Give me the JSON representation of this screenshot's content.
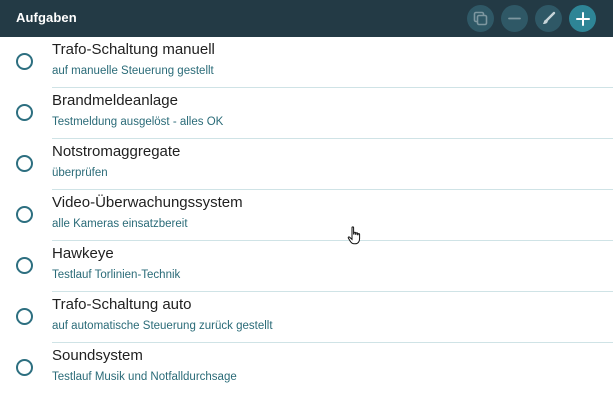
{
  "header": {
    "title": "Aufgaben",
    "buttons": [
      {
        "icon": "copy-icon"
      },
      {
        "icon": "minus-icon"
      },
      {
        "icon": "brush-icon"
      },
      {
        "icon": "plus-icon"
      }
    ]
  },
  "tasks": [
    {
      "title": "Trafo-Schaltung manuell",
      "subtitle": "auf manuelle Steuerung gestellt"
    },
    {
      "title": "Brandmeldeanlage",
      "subtitle": "Testmeldung ausgelöst - alles OK"
    },
    {
      "title": "Notstromaggregate",
      "subtitle": "überprüfen"
    },
    {
      "title": "Video-Überwachungssystem",
      "subtitle": "alle Kameras einsatzbereit"
    },
    {
      "title": "Hawkeye",
      "subtitle": "Testlauf Torlinien-Technik"
    },
    {
      "title": "Trafo-Schaltung auto",
      "subtitle": "auf automatische Steuerung zurück gestellt"
    },
    {
      "title": "Soundsystem",
      "subtitle": "Testlauf Musik und Notfalldurchsage"
    }
  ],
  "colors": {
    "header_bg": "#233a45",
    "accent": "#2e8596",
    "subtitle": "#2a6b78"
  }
}
